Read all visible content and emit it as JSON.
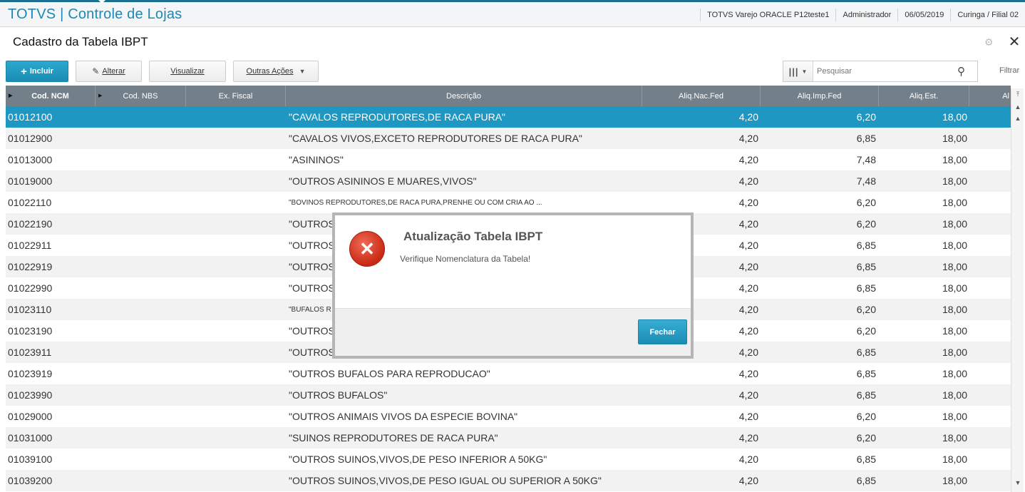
{
  "app": {
    "title": "TOTVS | Controle de Lojas",
    "environment": "TOTVS Varejo ORACLE P12teste1",
    "user": "Administrador",
    "date": "06/05/2019",
    "branch": "Curinga / Filial 02"
  },
  "page": {
    "title": "Cadastro da Tabela IBPT"
  },
  "toolbar": {
    "incluir_label": "Incluir",
    "alterar_label": "Alterar",
    "visualizar_label": "Visualizar",
    "outras_acoes_label": "Outras Ações",
    "search_placeholder": "Pesquisar",
    "filtrar_label": "Filtrar"
  },
  "grid": {
    "columns": [
      "Cod. NCM",
      "Cod. NBS",
      "Ex. Fiscal",
      "Descrição",
      "Aliq.Nac.Fed",
      "Aliq.Imp.Fed",
      "Aliq.Est.",
      "Al"
    ],
    "rows": [
      {
        "ncm": "01012100",
        "desc": "\"CAVALOS REPRODUTORES,DE RACA PURA\"",
        "nac": "4,20",
        "imp": "6,20",
        "est": "18,00"
      },
      {
        "ncm": "01012900",
        "desc": "\"CAVALOS VIVOS,EXCETO REPRODUTORES DE RACA PURA\"",
        "nac": "4,20",
        "imp": "6,85",
        "est": "18,00"
      },
      {
        "ncm": "01013000",
        "desc": "\"ASININOS\"",
        "nac": "4,20",
        "imp": "7,48",
        "est": "18,00"
      },
      {
        "ncm": "01019000",
        "desc": "\"OUTROS ASININOS E MUARES,VIVOS\"",
        "nac": "4,20",
        "imp": "7,48",
        "est": "18,00"
      },
      {
        "ncm": "01022110",
        "desc": "\"BOVINOS REPRODUTORES,DE RACA PURA,PRENHE OU COM CRIA AO ...",
        "nac": "4,20",
        "imp": "6,20",
        "est": "18,00"
      },
      {
        "ncm": "01022190",
        "desc": "\"OUTROS",
        "nac": "4,20",
        "imp": "6,20",
        "est": "18,00"
      },
      {
        "ncm": "01022911",
        "desc": "\"OUTROS",
        "nac": "4,20",
        "imp": "6,85",
        "est": "18,00"
      },
      {
        "ncm": "01022919",
        "desc": "\"OUTROS",
        "nac": "4,20",
        "imp": "6,85",
        "est": "18,00"
      },
      {
        "ncm": "01022990",
        "desc": "\"OUTROS",
        "nac": "4,20",
        "imp": "6,85",
        "est": "18,00"
      },
      {
        "ncm": "01023110",
        "desc": "\"BUFALOS R",
        "nac": "4,20",
        "imp": "6,20",
        "est": "18,00"
      },
      {
        "ncm": "01023190",
        "desc": "\"OUTROS",
        "nac": "4,20",
        "imp": "6,20",
        "est": "18,00"
      },
      {
        "ncm": "01023911",
        "desc": "\"OUTROS",
        "nac": "4,20",
        "imp": "6,85",
        "est": "18,00"
      },
      {
        "ncm": "01023919",
        "desc": "\"OUTROS BUFALOS PARA REPRODUCAO\"",
        "nac": "4,20",
        "imp": "6,85",
        "est": "18,00"
      },
      {
        "ncm": "01023990",
        "desc": "\"OUTROS BUFALOS\"",
        "nac": "4,20",
        "imp": "6,85",
        "est": "18,00"
      },
      {
        "ncm": "01029000",
        "desc": "\"OUTROS ANIMAIS VIVOS DA ESPECIE BOVINA\"",
        "nac": "4,20",
        "imp": "6,20",
        "est": "18,00"
      },
      {
        "ncm": "01031000",
        "desc": "\"SUINOS  REPRODUTORES DE RACA PURA\"",
        "nac": "4,20",
        "imp": "6,20",
        "est": "18,00"
      },
      {
        "ncm": "01039100",
        "desc": "\"OUTROS SUINOS,VIVOS,DE PESO INFERIOR A 50KG\"",
        "nac": "4,20",
        "imp": "6,85",
        "est": "18,00"
      },
      {
        "ncm": "01039200",
        "desc": "\"OUTROS SUINOS,VIVOS,DE PESO IGUAL OU SUPERIOR A 50KG\"",
        "nac": "4,20",
        "imp": "6,85",
        "est": "18,00"
      }
    ]
  },
  "modal": {
    "title": "Atualização Tabela IBPT",
    "message": "Verifique Nomenclatura da Tabela!",
    "close_label": "Fechar",
    "icon": "error-icon"
  },
  "colors": {
    "accent": "#1e88b4",
    "selected_row": "#1e97c2",
    "header_bg": "#73808a",
    "error": "#d63a22"
  }
}
